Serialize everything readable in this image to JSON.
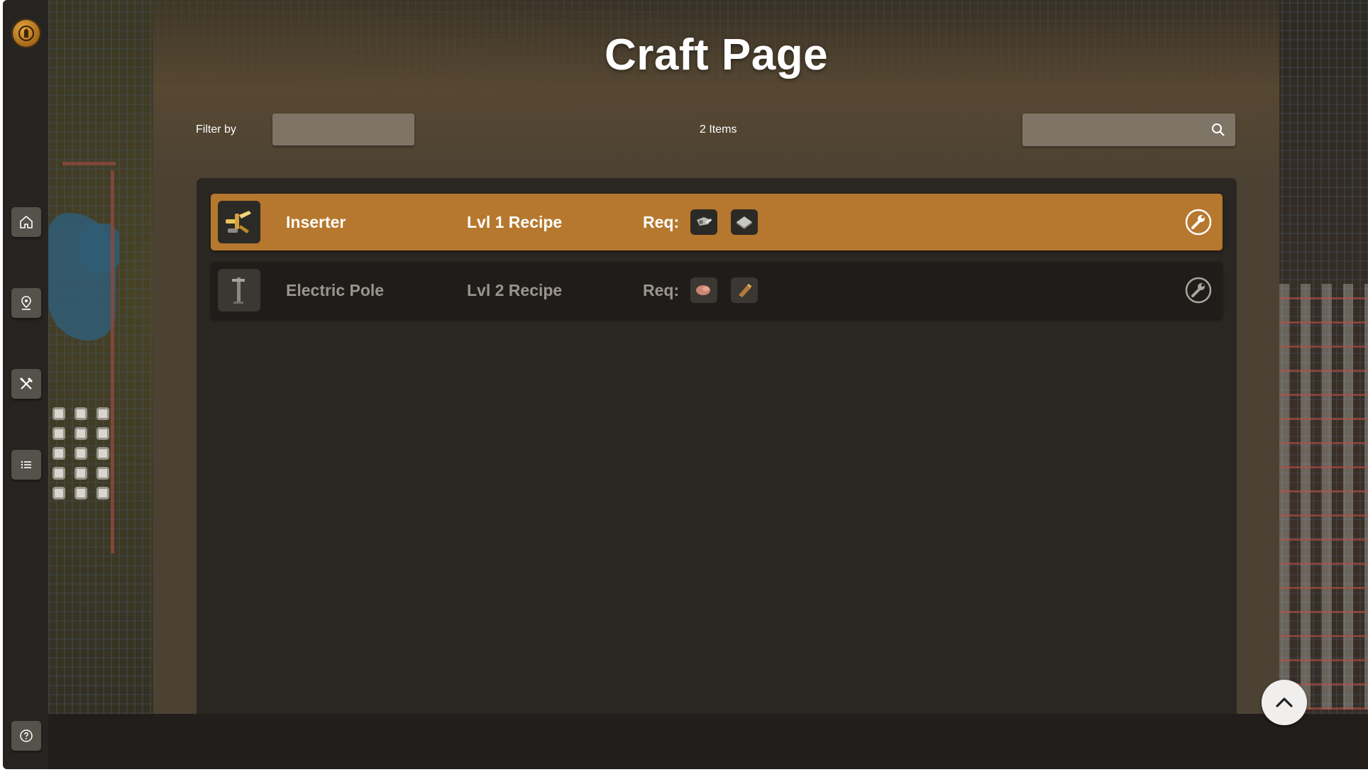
{
  "nav": {
    "logo_icon": "gear-hand-logo-icon",
    "items": [
      {
        "icon": "home-icon"
      },
      {
        "icon": "map-pin-icon"
      },
      {
        "icon": "crossed-tools-icon"
      },
      {
        "icon": "list-icon"
      }
    ],
    "help_icon": "question-circle-icon"
  },
  "header": {
    "title": "Craft Page"
  },
  "toolbar": {
    "filter_label": "Filter by",
    "filter_value": "",
    "item_count": "2 Items",
    "search_value": "",
    "search_icon": "search-icon"
  },
  "recipes": [
    {
      "name": "Inserter",
      "level": "Lvl 1 Recipe",
      "req_label": "Req:",
      "requirements": [
        "gear-wheel-icon",
        "iron-plate-icon"
      ],
      "icon": "inserter-icon",
      "state": "active"
    },
    {
      "name": "Electric Pole",
      "level": "Lvl 2 Recipe",
      "req_label": "Req:",
      "requirements": [
        "copper-ore-icon",
        "wood-icon"
      ],
      "icon": "electric-pole-icon",
      "state": "inactive"
    }
  ],
  "colors": {
    "accent": "#b6782e",
    "panel": "#2a2621",
    "row_inactive": "#1f1c19",
    "sidebar": "#262420"
  },
  "floating": {
    "scroll_top_icon": "chevron-up-icon"
  }
}
